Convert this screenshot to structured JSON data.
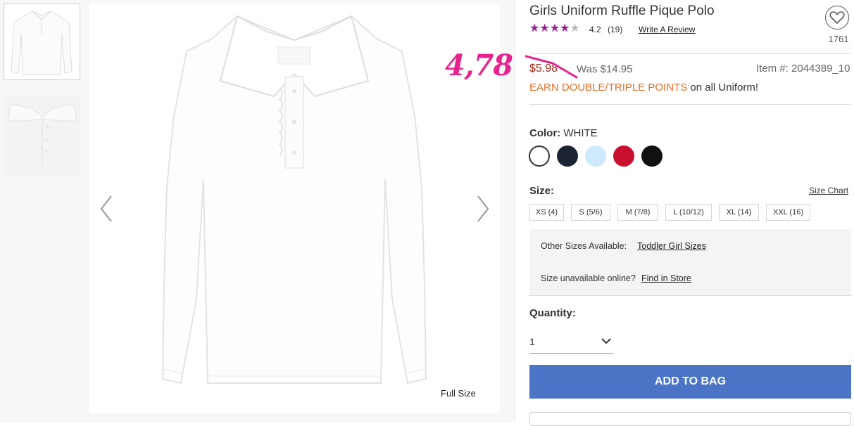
{
  "gallery": {
    "full_size_label": "Full Size",
    "handwritten_price": "4,78"
  },
  "product": {
    "title": "Girls Uniform Ruffle Pique Polo",
    "rating": "4.2",
    "rating_value": 4.2,
    "review_count": "(19)",
    "write_review": "Write A Review",
    "favorite_count": "1761",
    "price": "$5.98",
    "was_price": "Was $14.95",
    "item_number": "Item #: 2044389_10",
    "points_highlight": "EARN DOUBLE/TRIPLE POINTS",
    "points_rest": " on all Uniform!"
  },
  "color": {
    "label": "Color: ",
    "selected": "WHITE",
    "swatches": [
      {
        "name": "white",
        "hex": "#ffffff"
      },
      {
        "name": "navy",
        "hex": "#1c2333"
      },
      {
        "name": "light-blue",
        "hex": "#cde9fb"
      },
      {
        "name": "red",
        "hex": "#c8102e"
      },
      {
        "name": "black",
        "hex": "#111111"
      }
    ]
  },
  "size": {
    "label": "Size:",
    "chart_link": "Size Chart",
    "options": [
      "XS (4)",
      "S (5/6)",
      "M (7/8)",
      "L (10/12)",
      "XL (14)",
      "XXL (16)"
    ]
  },
  "other_sizes": {
    "label": "Other Sizes Available:",
    "link": "Toddler Girl Sizes"
  },
  "unavailable": {
    "label": "Size unavailable online?",
    "link": "Find in Store"
  },
  "quantity": {
    "label": "Quantity:",
    "value": "1"
  },
  "cta": {
    "add_to_bag": "ADD TO BAG"
  },
  "colors": {
    "price_red": "#a62a1e",
    "points_orange": "#e56f2a",
    "button_blue": "#4b74c6",
    "star_purple": "#9a1e8f",
    "annotation_pink": "#e8228c"
  }
}
